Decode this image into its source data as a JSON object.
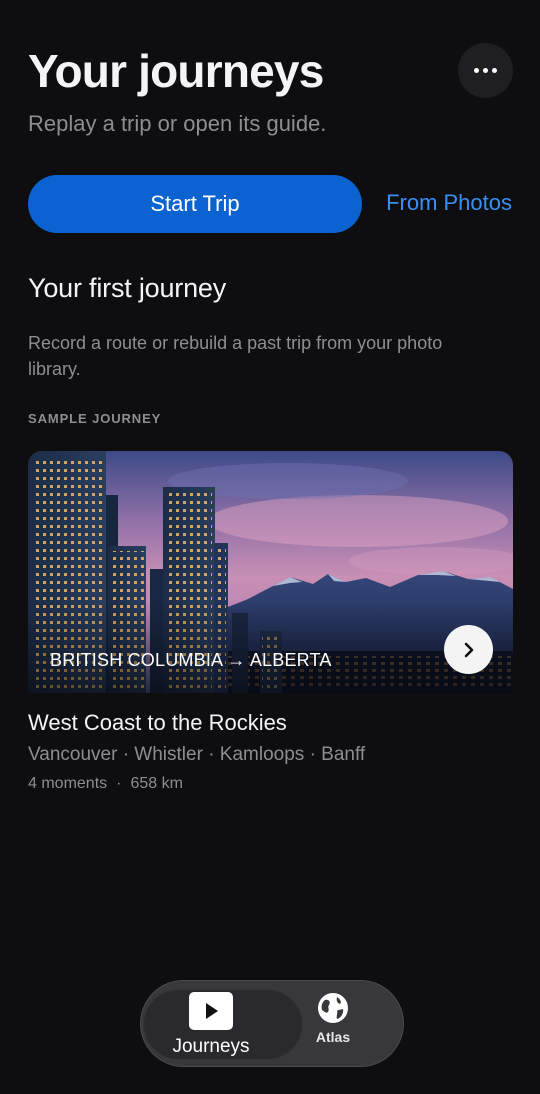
{
  "header": {
    "title": "Your journeys",
    "subtitle": "Replay a trip or open its guide."
  },
  "actions": {
    "start_trip_label": "Start Trip",
    "from_photos_label": "From Photos"
  },
  "first_journey": {
    "heading": "Your first journey",
    "description": "Record a route or rebuild a past trip from your photo library.",
    "eyebrow": "SAMPLE JOURNEY"
  },
  "sample_card": {
    "route_label": "BRITISH COLUMBIA → ALBERTA",
    "name": "West Coast to the Rockies",
    "places": "Vancouver · Whistler · Kamloops · Banff",
    "moments": "4 moments",
    "separator": "·",
    "distance": "658 km"
  },
  "tabbar": {
    "tabs": [
      {
        "label": "Journeys",
        "icon": "play-icon",
        "active": true
      },
      {
        "label": "Atlas",
        "icon": "globe-icon",
        "active": false
      }
    ]
  },
  "colors": {
    "background": "#0e0e10",
    "accent": "#0a63d1",
    "link": "#3b8ff3",
    "muted_text": "#8d8d93"
  }
}
